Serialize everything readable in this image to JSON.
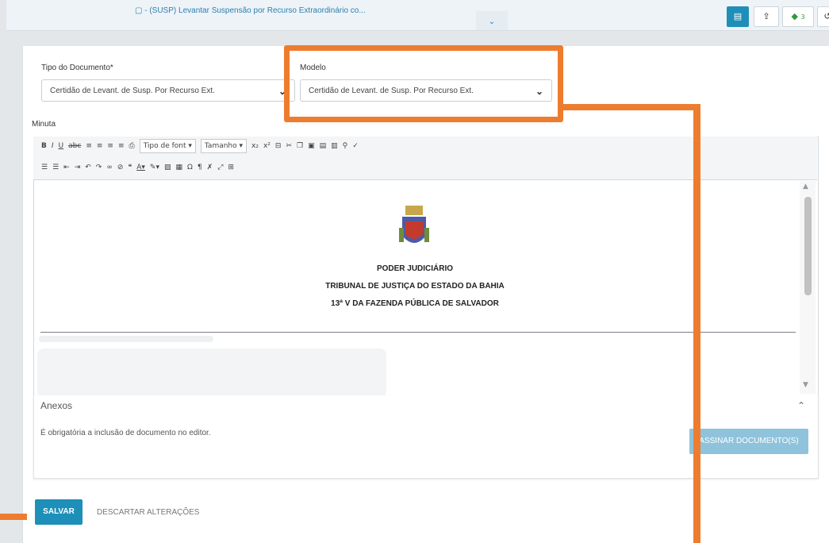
{
  "header": {
    "task_title": "▢ - (SUSP) Levantar Suspensão por Recurso Extraordinário co...",
    "tag_count": "3"
  },
  "form": {
    "tipo_label": "Tipo do Documento*",
    "tipo_value": "Certidão de Levant. de Susp. Por Recurso Ext.",
    "modelo_label": "Modelo",
    "modelo_value": "Certidão de Levant. de Susp. Por Recurso Ext.",
    "minuta_label": "Minuta"
  },
  "editor_toolbar": {
    "font_select": "Tipo de font",
    "size_select": "Tamanho"
  },
  "document": {
    "line1": "PODER JUDICIÁRIO",
    "line2": "TRIBUNAL  DE JUSTIÇA DO ESTADO DA BAHIA",
    "line3": "13ª V DA FAZENDA PÚBLICA DE SALVADOR"
  },
  "anexos": {
    "title": "Anexos",
    "message": "É obrigatória a inclusão de documento no editor.",
    "sign_button": "ASSINAR DOCUMENTO(S)"
  },
  "actions": {
    "save": "SALVAR",
    "discard": "DESCARTAR ALTERAÇÕES"
  },
  "colors": {
    "accent": "#1e8fb8",
    "highlight": "#ee7c2f"
  }
}
